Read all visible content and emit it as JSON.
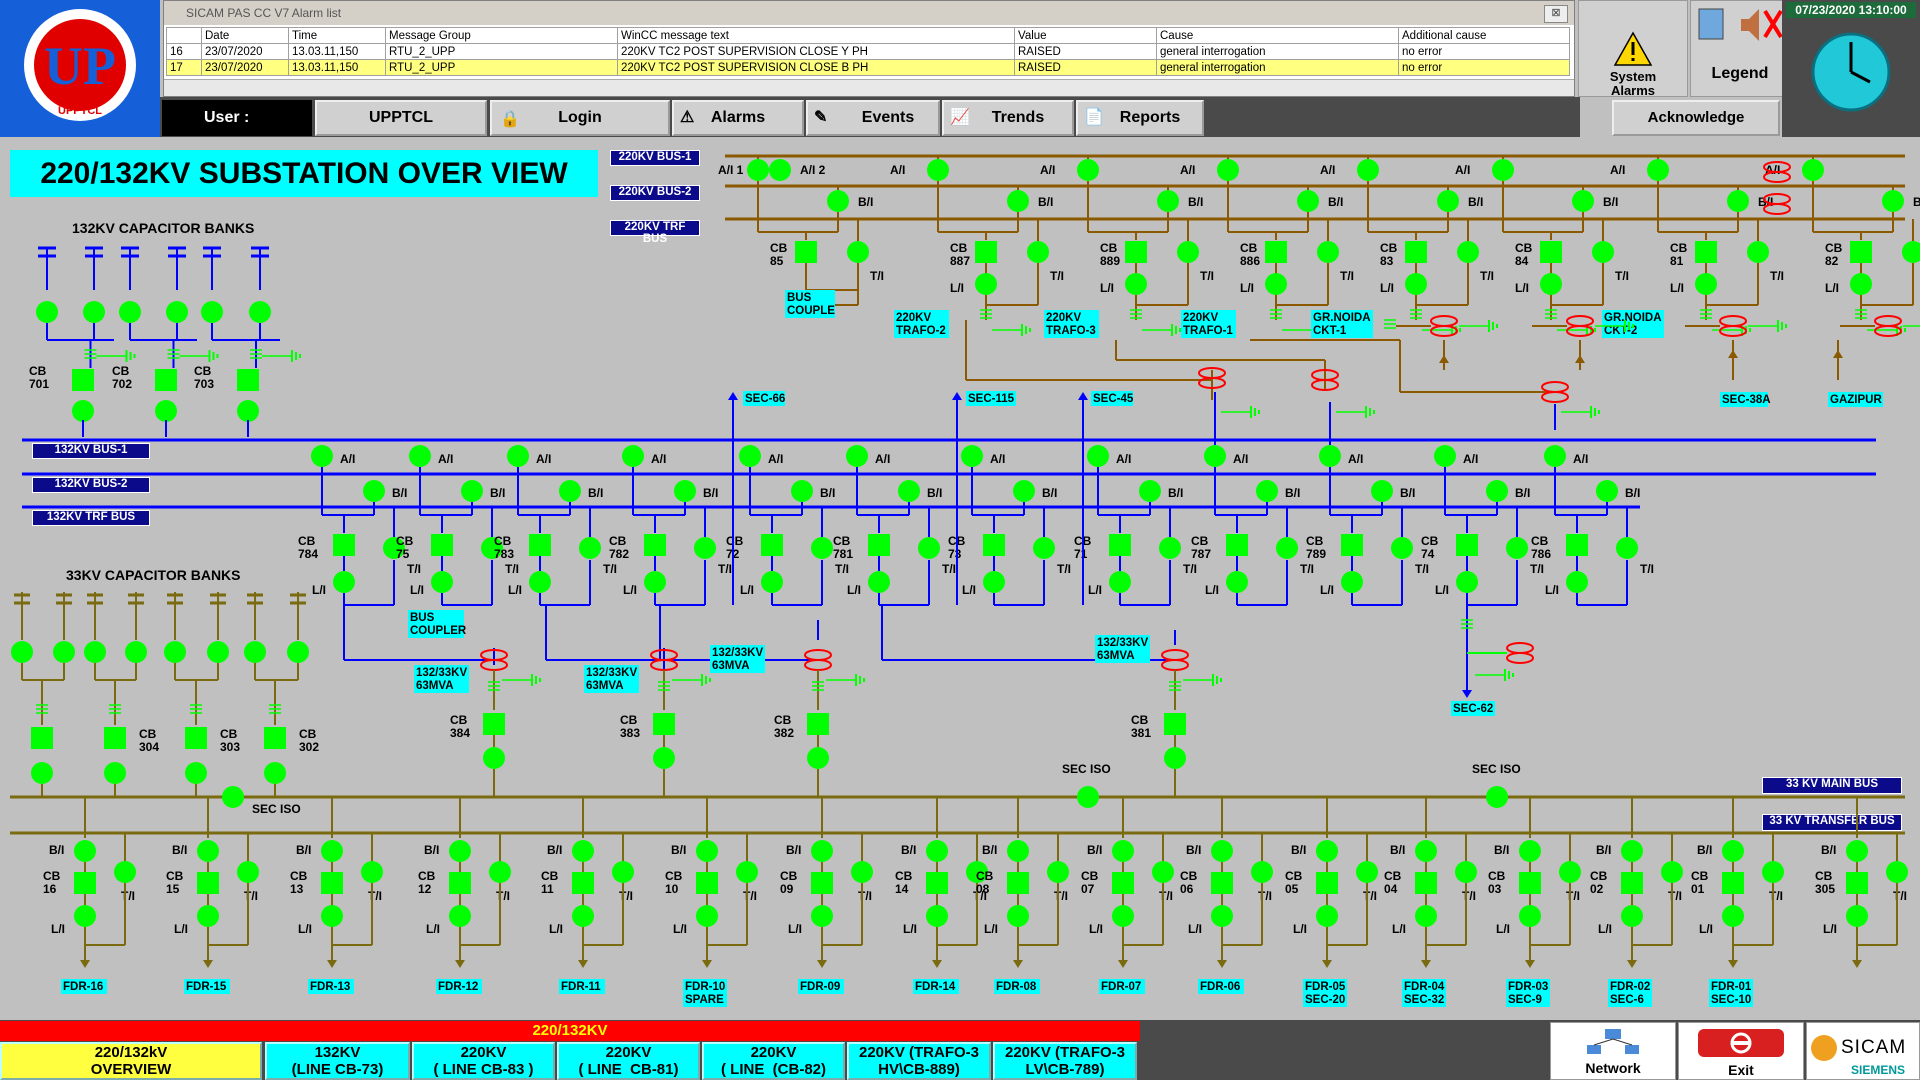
{
  "logo": {
    "text": "UP",
    "subtext": "UPPTCL",
    "ring": "U.P. POWER TRANSMISSION CORPORATION LIMITED"
  },
  "alarm_window": {
    "title": "SICAM PAS CC V7 Alarm list",
    "close": "⊠",
    "columns": [
      "",
      "Date",
      "Time",
      "Message Group",
      "WinCC message text",
      "Value",
      "Cause",
      "Additional cause"
    ],
    "rows": [
      [
        "16",
        "23/07/2020",
        "13.03.11,150",
        "RTU_2_UPP",
        "220KV TC2 POST SUPERVISION CLOSE Y PH",
        "RAISED",
        "general interrogation",
        "no error"
      ],
      [
        "17",
        "23/07/2020",
        "13.03.11,150",
        "RTU_2_UPP",
        "220KV TC2 POST SUPERVISION CLOSE B PH",
        "RAISED",
        "general interrogation",
        "no error"
      ]
    ]
  },
  "system_alarms": {
    "label": "System Alarms"
  },
  "legend": {
    "label": "Legend"
  },
  "clock": {
    "datetime": "07/23/2020 13:10:00"
  },
  "toolbar": {
    "user_label": "User :",
    "user_value": "UPPTCL",
    "login": "Login",
    "alarms": "Alarms",
    "events": "Events",
    "trends": "Trends",
    "reports": "Reports",
    "acknowledge": "Acknowledge"
  },
  "title": "220/132KV SUBSTATION OVER VIEW",
  "buses": {
    "b220_1": "220KV BUS-1",
    "b220_2": "220KV BUS-2",
    "b220_trf": "220KV TRF BUS",
    "b132_1": "132KV BUS-1",
    "b132_2": "132KV BUS-2",
    "b132_trf": "132KV TRF BUS",
    "b33_main": "33 KV MAIN BUS",
    "b33_trf": "33 KV TRANSFER BUS"
  },
  "sections": {
    "cap132": "132KV CAPACITOR BANKS",
    "cap33": "33KV CAPACITOR BANKS"
  },
  "bay220": [
    {
      "cb": "85",
      "name": "BUS\nCOUPLE"
    },
    {
      "cb": "887",
      "name": "220KV\nTRAFO-2"
    },
    {
      "cb": "889",
      "name": "220KV\nTRAFO-3"
    },
    {
      "cb": "886",
      "name": "220KV\nTRAFO-1"
    },
    {
      "cb": "83",
      "name": "GR.NOIDA\nCKT-1"
    },
    {
      "cb": "84",
      "name": ""
    },
    {
      "cb": "81",
      "name": "GR.NOIDA\nCKT-2"
    },
    {
      "cb": "82",
      "name": ""
    }
  ],
  "feeders220": [
    "SEC-38A",
    "GAZIPUR"
  ],
  "sec132_top": [
    "SEC-66",
    "SEC-115",
    "SEC-45"
  ],
  "bay132": [
    "784",
    "75",
    "783",
    "782",
    "72",
    "781",
    "73",
    "71",
    "787",
    "789",
    "74",
    "786"
  ],
  "bus_coupler_132": "BUS\nCOUPLER",
  "cap132_cbs": [
    "701",
    "702",
    "703"
  ],
  "trafos": [
    {
      "label": "132/33KV\n63MVA",
      "cb": "384"
    },
    {
      "label": "132/33KV\n63MVA",
      "cb": "383"
    },
    {
      "label": "132/33KV\n63MVA",
      "cb": "382"
    },
    {
      "label": "132/33KV\n63MVA",
      "cb": "381"
    }
  ],
  "sec62": "SEC-62",
  "cap33_cbs": [
    "304",
    "303",
    "302"
  ],
  "sec_iso": "SEC ISO",
  "feeders33": [
    {
      "cb": "16",
      "name": "FDR-16"
    },
    {
      "cb": "15",
      "name": "FDR-15"
    },
    {
      "cb": "13",
      "name": "FDR-13"
    },
    {
      "cb": "12",
      "name": "FDR-12"
    },
    {
      "cb": "11",
      "name": "FDR-11"
    },
    {
      "cb": "10",
      "name": "FDR-10\nSPARE"
    },
    {
      "cb": "09",
      "name": "FDR-09"
    },
    {
      "cb": "14",
      "name": "FDR-14"
    },
    {
      "cb": "08",
      "name": "FDR-08"
    },
    {
      "cb": "07",
      "name": "FDR-07"
    },
    {
      "cb": "06",
      "name": "FDR-06"
    },
    {
      "cb": "05",
      "name": "FDR-05\nSEC-20"
    },
    {
      "cb": "04",
      "name": "FDR-04\nSEC-32"
    },
    {
      "cb": "03",
      "name": "FDR-03\nSEC-9"
    },
    {
      "cb": "02",
      "name": "FDR-02\nSEC-6"
    },
    {
      "cb": "01",
      "name": "FDR-01\nSEC-10"
    },
    {
      "cb": "305",
      "name": ""
    }
  ],
  "labels": {
    "ai": "A/I",
    "ai1": "A/I 1",
    "ai2": "A/I 2",
    "bi": "B/I",
    "ti": "T/I",
    "li": "L/I",
    "cb": "CB"
  },
  "bottom": {
    "red_title": "220/132KV",
    "tabs": [
      "220/132kV\nOVERVIEW",
      "132KV\n(LINE CB-73)",
      "220KV\n( LINE CB-83 )",
      "220KV\n( LINE  CB-81)",
      "220KV\n( LINE  (CB-82)",
      "220KV (TRAFO-3\nHV\\CB-889)",
      "220KV (TRAFO-3\nLV\\CB-789)"
    ],
    "network": "Network",
    "exit": "Exit",
    "sicam": "SICAM",
    "siemens": "SIEMENS"
  },
  "colors": {
    "green": "#00ff00",
    "blue": "#0000ff",
    "brown": "#8b5a00",
    "olive": "#7a6a10",
    "cyan": "#00ffff",
    "red": "#ff0000",
    "navy": "#0a0a8a"
  }
}
